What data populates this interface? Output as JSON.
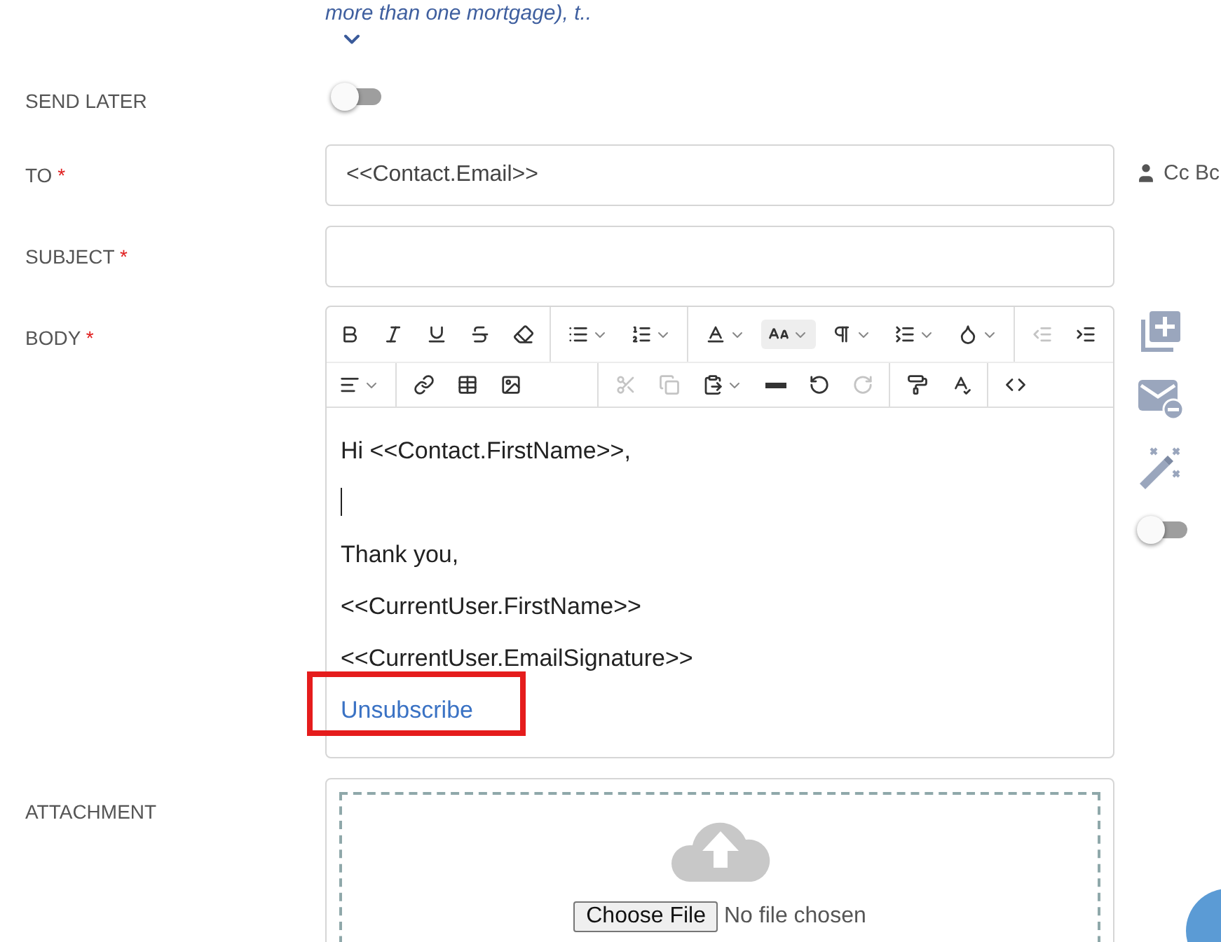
{
  "snippet": {
    "text": "more than one mortgage), t..",
    "expanded": false
  },
  "send_later": {
    "label": "SEND LATER",
    "on": false
  },
  "to": {
    "label": "TO",
    "required_mark": "*",
    "value": "<<Contact.Email>>",
    "cc_bcc": "Cc Bc"
  },
  "subject": {
    "label": "SUBJECT",
    "required_mark": "*"
  },
  "body": {
    "label": "BODY",
    "required_mark": "*",
    "toolbar": [
      [
        [
          {
            "kind": "bold",
            "disabled": false,
            "dropdown": false,
            "active": false
          },
          {
            "kind": "italic",
            "disabled": false,
            "dropdown": false,
            "active": false
          },
          {
            "kind": "underline",
            "disabled": false,
            "dropdown": false,
            "active": false
          },
          {
            "kind": "strike",
            "disabled": false,
            "dropdown": false,
            "active": false
          },
          {
            "kind": "eraser",
            "disabled": false,
            "dropdown": false,
            "active": false
          }
        ],
        [
          {
            "kind": "bullets",
            "disabled": false,
            "dropdown": true,
            "active": false
          },
          {
            "kind": "numbers",
            "disabled": false,
            "dropdown": true,
            "active": false
          }
        ],
        [
          {
            "kind": "font",
            "disabled": false,
            "dropdown": true,
            "active": false
          },
          {
            "kind": "size",
            "disabled": false,
            "dropdown": true,
            "active": true
          },
          {
            "kind": "paragraph",
            "disabled": false,
            "dropdown": true,
            "active": false
          },
          {
            "kind": "line-height",
            "disabled": false,
            "dropdown": true,
            "active": false
          },
          {
            "kind": "color",
            "disabled": false,
            "dropdown": true,
            "active": false
          }
        ],
        [
          {
            "kind": "outdent",
            "disabled": true,
            "dropdown": false,
            "active": false
          },
          {
            "kind": "indent",
            "disabled": false,
            "dropdown": false,
            "active": false
          }
        ]
      ],
      [
        [
          {
            "kind": "align",
            "disabled": false,
            "dropdown": true,
            "active": false
          }
        ],
        [
          {
            "kind": "link",
            "disabled": false,
            "dropdown": false,
            "active": false
          },
          {
            "kind": "table",
            "disabled": false,
            "dropdown": false,
            "active": false
          },
          {
            "kind": "image",
            "disabled": false,
            "dropdown": false,
            "active": false
          }
        ],
        [
          {
            "kind": "cut",
            "disabled": true,
            "dropdown": false,
            "active": false
          },
          {
            "kind": "copy",
            "disabled": true,
            "dropdown": false,
            "active": false
          },
          {
            "kind": "paste",
            "disabled": false,
            "dropdown": true,
            "active": false
          },
          {
            "kind": "rule",
            "disabled": false,
            "dropdown": false,
            "active": false
          },
          {
            "kind": "undo",
            "disabled": false,
            "dropdown": false,
            "active": false
          },
          {
            "kind": "redo",
            "disabled": true,
            "dropdown": false,
            "active": false
          }
        ],
        [
          {
            "kind": "painter",
            "disabled": false,
            "dropdown": false,
            "active": false
          },
          {
            "kind": "spell",
            "disabled": false,
            "dropdown": false,
            "active": false
          }
        ],
        [
          {
            "kind": "code",
            "disabled": false,
            "dropdown": false,
            "active": false
          }
        ]
      ]
    ],
    "lines": [
      {
        "kind": "text",
        "text": "Hi <<Contact.FirstName>>,"
      },
      {
        "kind": "cursor"
      },
      {
        "kind": "text",
        "text": "Thank you,"
      },
      {
        "kind": "text",
        "text": "<<CurrentUser.FirstName>>"
      },
      {
        "kind": "text",
        "text": "<<CurrentUser.EmailSignature>>"
      },
      {
        "kind": "link",
        "text": "Unsubscribe",
        "highlighted": true
      }
    ]
  },
  "side_tools": [
    {
      "kind": "add"
    },
    {
      "kind": "mail-remove"
    },
    {
      "kind": "wand"
    },
    {
      "kind": "toggle",
      "on": false
    }
  ],
  "attachment": {
    "label": "ATTACHMENT",
    "button": "Choose File",
    "status": "No file chosen"
  }
}
